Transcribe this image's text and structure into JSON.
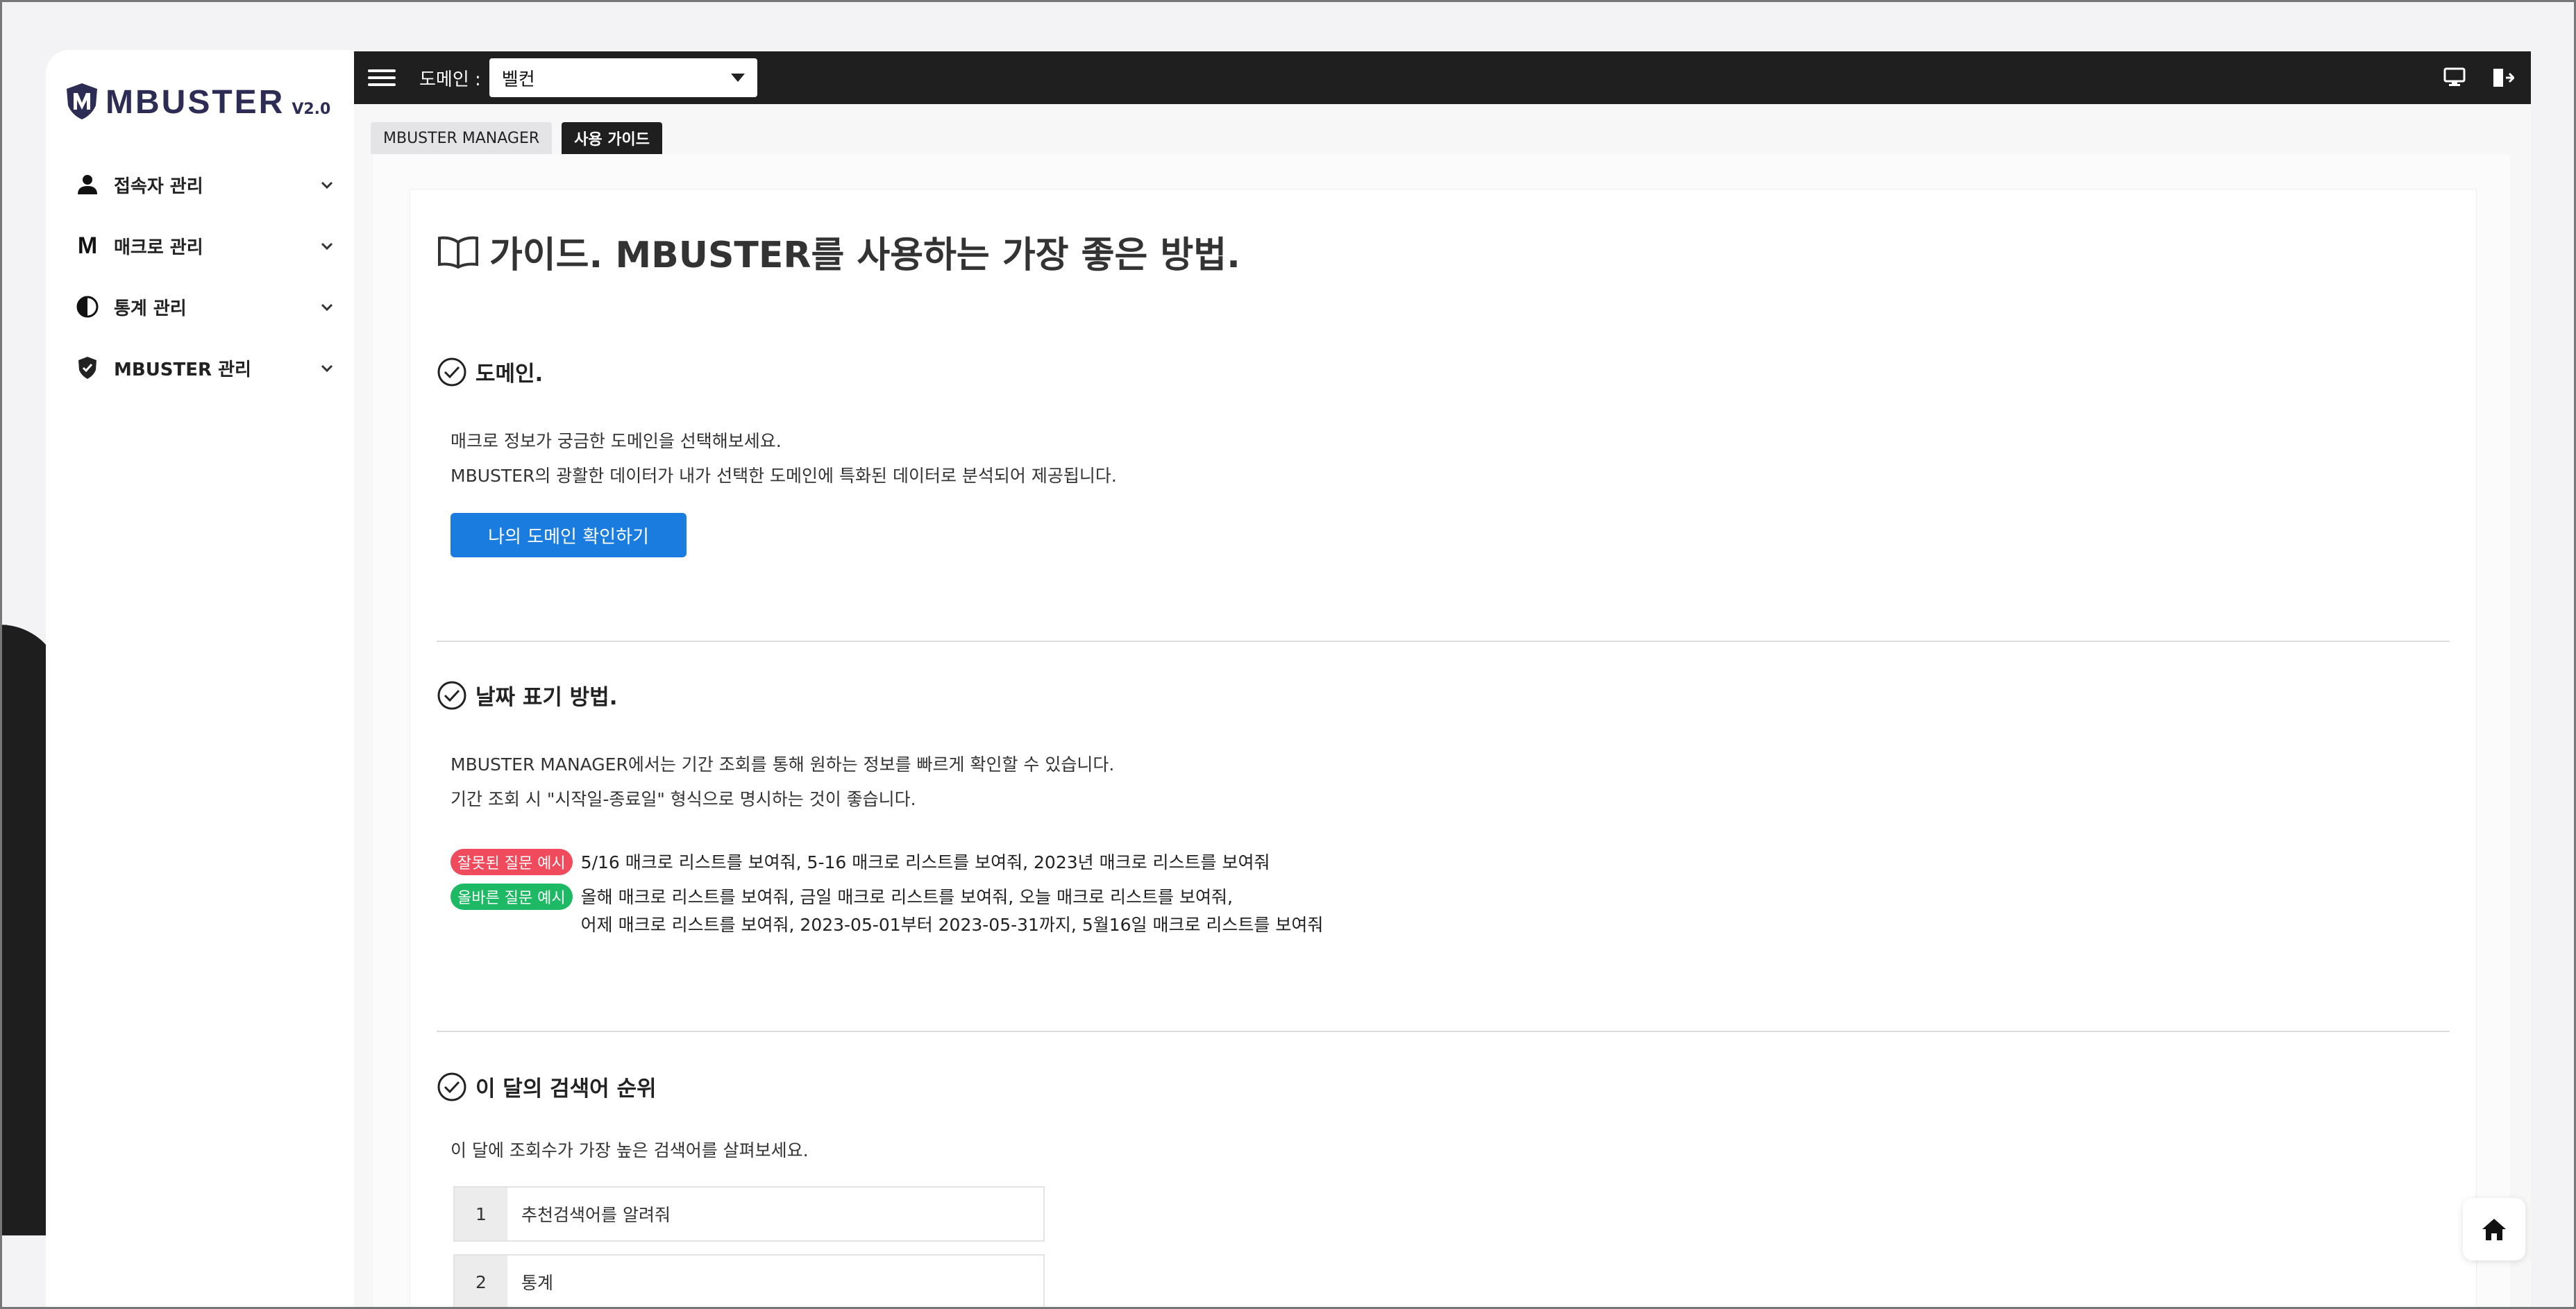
{
  "brand": {
    "name": "MBUSTER",
    "version": "V2.0"
  },
  "sidebar": {
    "items": [
      {
        "label": "접속자 관리",
        "icon": "user-icon"
      },
      {
        "label": "매크로 관리",
        "icon": "m-letter-icon"
      },
      {
        "label": "통계 관리",
        "icon": "pie-chart-icon"
      },
      {
        "label": "MBUSTER 관리",
        "icon": "shield-check-icon"
      }
    ]
  },
  "topbar": {
    "domain_label": "도메인 :",
    "domain_value": "벨컨",
    "icons": [
      "monitor-icon",
      "logout-icon"
    ]
  },
  "tabs": [
    {
      "label": "MBUSTER MANAGER",
      "active": false
    },
    {
      "label": "사용 가이드",
      "active": true
    }
  ],
  "guide": {
    "title": "가이드. MBUSTER를 사용하는 가장 좋은 방법.",
    "sections": {
      "domain": {
        "heading": "도메인.",
        "line1": "매크로 정보가 궁금한 도메인을 선택해보세요.",
        "line2": "MBUSTER의 광활한 데이터가 내가 선택한 도메인에 특화된 데이터로 분석되어 제공됩니다.",
        "button": "나의 도메인 확인하기"
      },
      "date": {
        "heading": "날짜 표기 방법.",
        "line1": "MBUSTER MANAGER에서는 기간 조회를 통해 원하는 정보를 빠르게 확인할 수 있습니다.",
        "line2": "기간 조회 시 \"시작일-종료일\" 형식으로 명시하는 것이 좋습니다.",
        "bad_badge": "잘못된 질문 예시",
        "bad_text": "5/16 매크로 리스트를 보여줘, 5-16 매크로 리스트를 보여줘, 2023년 매크로 리스트를 보여줘",
        "good_badge": "올바른 질문 예시",
        "good_text_1": "올해 매크로 리스트를 보여줘, 금일 매크로 리스트를 보여줘, 오늘 매크로 리스트를 보여줘,",
        "good_text_2": "어제 매크로 리스트를 보여줘, 2023-05-01부터 2023-05-31까지, 5월16일 매크로 리스트를 보여줘"
      },
      "ranking": {
        "heading": "이 달의 검색어 순위",
        "line1": "이 달에 조회수가 가장 높은 검색어를 살펴보세요.",
        "rows": [
          {
            "rank": "1",
            "term": "추천검색어를 알려줘"
          },
          {
            "rank": "2",
            "term": "통계"
          }
        ]
      }
    }
  },
  "colors": {
    "topbar": "#1f1f1f",
    "primary_button": "#1b7ce0",
    "bad_badge": "#ef4b5c",
    "good_badge": "#1eb964",
    "brand_text": "#2c2c55"
  },
  "home_button_icon": "home-icon"
}
